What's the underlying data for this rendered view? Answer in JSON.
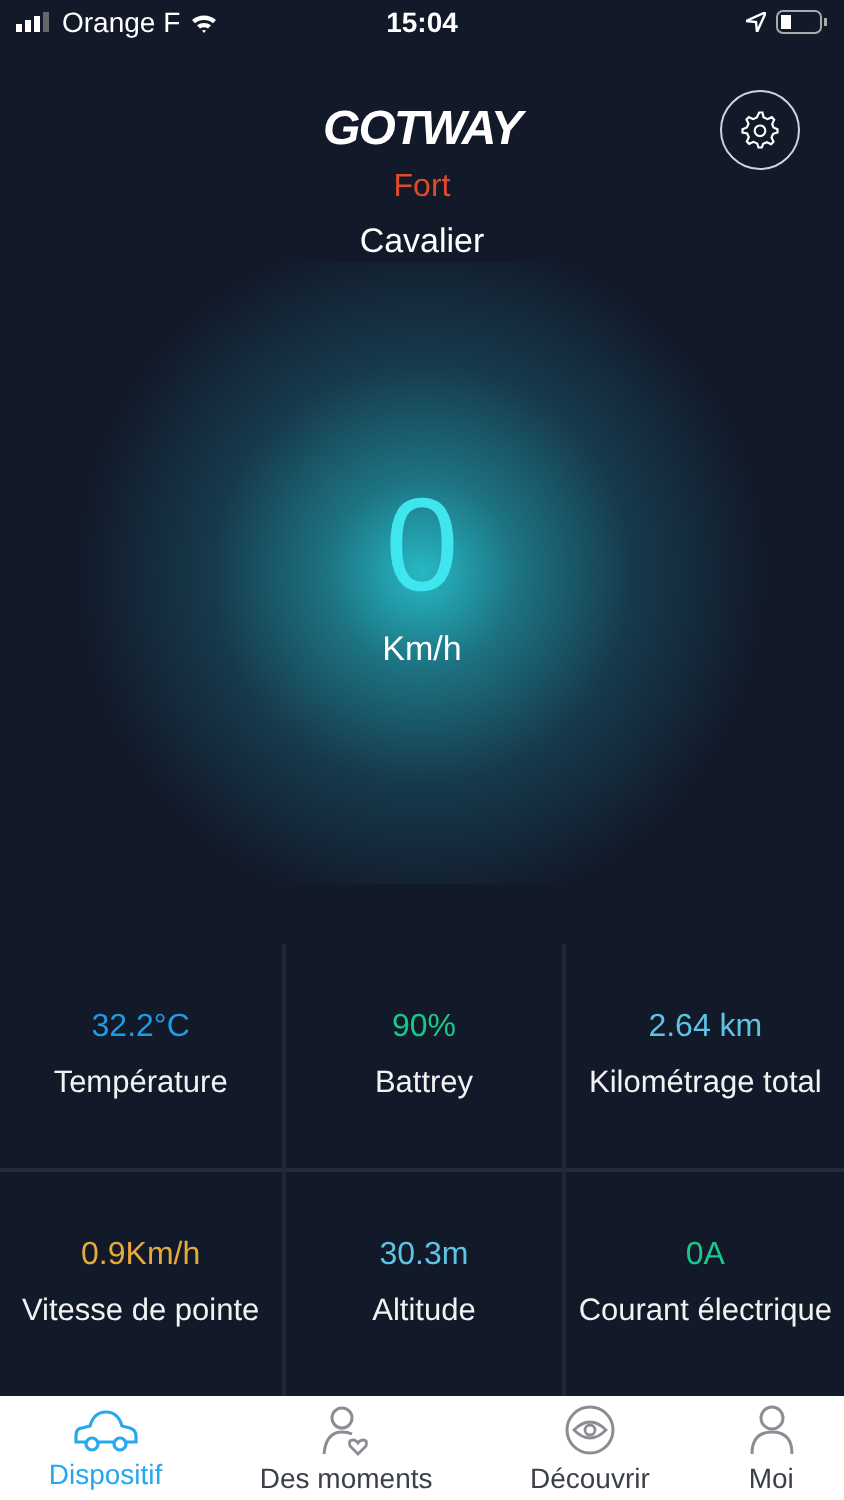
{
  "status_bar": {
    "carrier": "Orange F",
    "time": "15:04"
  },
  "header": {
    "logo": "GOTWAY",
    "mode": "Fort",
    "role": "Cavalier"
  },
  "speed": {
    "value": "0",
    "unit": "Km/h"
  },
  "stats": [
    {
      "value": "32.2°C",
      "label": "Température",
      "color": "#1e9be8"
    },
    {
      "value": "90%",
      "label": "Battrey",
      "color": "#17c98a"
    },
    {
      "value": "2.64 km",
      "label": "Kilométrage total",
      "color": "#5ec4e6"
    },
    {
      "value": "0.9Km/h",
      "label": "Vitesse de pointe",
      "color": "#e6a93a"
    },
    {
      "value": "30.3m",
      "label": "Altitude",
      "color": "#5ec4e6"
    },
    {
      "value": "0A",
      "label": "Courant électrique",
      "color": "#17c98a"
    }
  ],
  "tabs": [
    {
      "label": "Dispositif",
      "kind": "car",
      "selected": true
    },
    {
      "label": "Des moments",
      "kind": "moments",
      "selected": false
    },
    {
      "label": "Découvrir",
      "kind": "eye",
      "selected": false
    },
    {
      "label": "Moi",
      "kind": "person",
      "selected": false
    }
  ]
}
